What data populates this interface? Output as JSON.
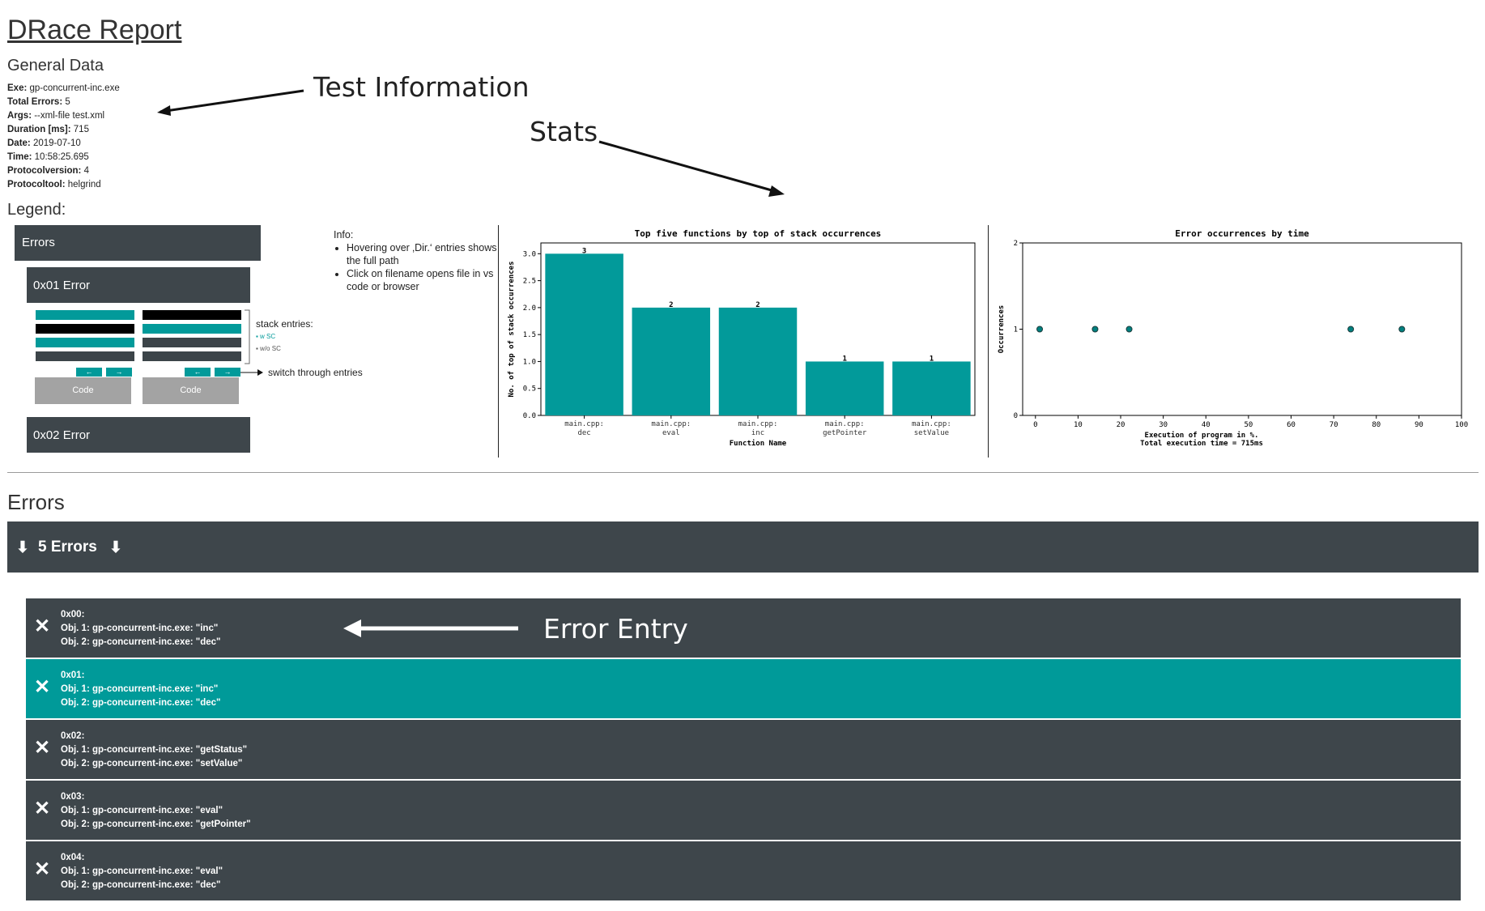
{
  "title": "DRace Report",
  "general": {
    "heading": "General Data",
    "fields": [
      {
        "key": "Exe:",
        "value": " gp-concurrent-inc.exe"
      },
      {
        "key": "Total Errors:",
        "value": " 5"
      },
      {
        "key": "Args:",
        "value": " --xml-file test.xml"
      },
      {
        "key": "Duration [ms]:",
        "value": " 715"
      },
      {
        "key": "Date:",
        "value": " 2019-07-10"
      },
      {
        "key": "Time:",
        "value": " 10:58:25.695"
      },
      {
        "key": "Protocolversion:",
        "value": " 4"
      },
      {
        "key": "Protocoltool:",
        "value": " helgrind"
      }
    ]
  },
  "annotations": {
    "test_information": "Test Information",
    "stats": "Stats",
    "error_entry": "Error Entry"
  },
  "legend": {
    "heading": "Legend:",
    "errors_bar": "Errors",
    "error1": "0x01 Error",
    "error2": "0x02 Error",
    "stack_entries": "stack entries:",
    "w_sc": "▪ w SC",
    "wo_sc": "▪ w/o SC",
    "switch_entries": "switch through entries",
    "code_label": "Code",
    "prev_arrow": "←",
    "next_arrow": "→"
  },
  "info": {
    "heading": "Info:",
    "bullets": [
      "Hovering over ‚Dir.‘ entries shows the full path",
      "Click on filename opens file in vs code or browser"
    ]
  },
  "colors": {
    "teal": "#029a9a",
    "dark": "#3e464b",
    "code_gray": "#a3a3a3"
  },
  "chart_data": [
    {
      "type": "bar",
      "title": "Top five functions by top of stack occurrences",
      "xlabel": "Function Name",
      "ylabel": "No. of top of stack occurrences",
      "categories": [
        [
          "main.cpp:",
          "dec"
        ],
        [
          "main.cpp:",
          "eval"
        ],
        [
          "main.cpp:",
          "inc"
        ],
        [
          "main.cpp:",
          "getPointer"
        ],
        [
          "main.cpp:",
          "setValue"
        ]
      ],
      "values": [
        3,
        2,
        2,
        1,
        1
      ],
      "data_labels": [
        "3",
        "2",
        "2",
        "1",
        "1"
      ],
      "ylim": [
        0,
        3.2
      ],
      "yticks": [
        "0.0",
        "0.5",
        "1.0",
        "1.5",
        "2.0",
        "2.5",
        "3.0"
      ],
      "color": "#029a9a",
      "grid": false
    },
    {
      "type": "scatter",
      "title": "Error occurrences by time",
      "xlabel": "Execution of program in %.",
      "xlabel2": "Total execution time = 715ms",
      "ylabel": "Occurrences",
      "x": [
        1,
        14,
        22,
        74,
        86
      ],
      "y": [
        1,
        1,
        1,
        1,
        1
      ],
      "xlim": [
        -3,
        100
      ],
      "ylim": [
        0,
        2
      ],
      "xticks": [
        "0",
        "10",
        "20",
        "30",
        "40",
        "50",
        "60",
        "70",
        "80",
        "90",
        "100"
      ],
      "yticks": [
        "0",
        "1",
        "2"
      ],
      "color": "#00807f",
      "grid": false
    }
  ],
  "errors": {
    "heading": "Errors",
    "toggle_icon": "⬇",
    "count_label": "5 Errors",
    "close_icon": "✕",
    "entries": [
      {
        "id": "0x00:",
        "obj1": "Obj. 1: gp-concurrent-inc.exe: \"inc\"",
        "obj2": "Obj. 2: gp-concurrent-inc.exe: \"dec\"",
        "highlight": false
      },
      {
        "id": "0x01:",
        "obj1": "Obj. 1: gp-concurrent-inc.exe: \"inc\"",
        "obj2": "Obj. 2: gp-concurrent-inc.exe: \"dec\"",
        "highlight": true
      },
      {
        "id": "0x02:",
        "obj1": "Obj. 1: gp-concurrent-inc.exe: \"getStatus\"",
        "obj2": "Obj. 2: gp-concurrent-inc.exe: \"setValue\"",
        "highlight": false
      },
      {
        "id": "0x03:",
        "obj1": "Obj. 1: gp-concurrent-inc.exe: \"eval\"",
        "obj2": "Obj. 2: gp-concurrent-inc.exe: \"getPointer\"",
        "highlight": false
      },
      {
        "id": "0x04:",
        "obj1": "Obj. 1: gp-concurrent-inc.exe: \"eval\"",
        "obj2": "Obj. 2: gp-concurrent-inc.exe: \"dec\"",
        "highlight": false
      }
    ]
  }
}
